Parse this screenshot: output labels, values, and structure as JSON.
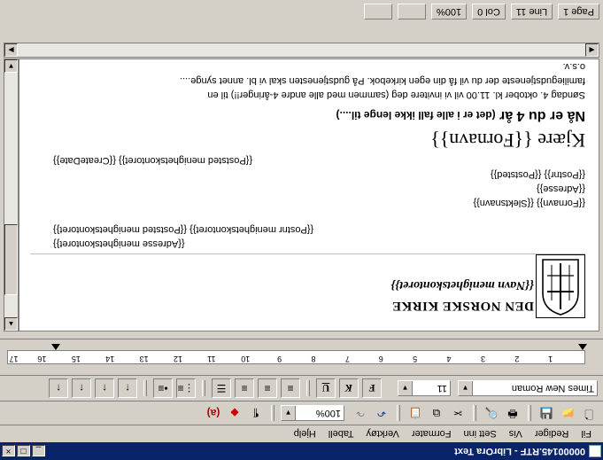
{
  "window": {
    "title": "00000145.RTF - LibrOra Text"
  },
  "menu": [
    "Fil",
    "Rediger",
    "Vis",
    "Sett inn",
    "Formater",
    "Verktøy",
    "Tabell",
    "Hjelp"
  ],
  "toolbar": {
    "zoom": "100%"
  },
  "format": {
    "font": "Times New Roman",
    "size": "11"
  },
  "ruler": {
    "numbers": [
      "1",
      "2",
      "3",
      "4",
      "5",
      "6",
      "7",
      "8",
      "9",
      "10",
      "11",
      "12",
      "13",
      "14",
      "15",
      "16",
      "17"
    ]
  },
  "document": {
    "church_name": "DEN NORSKE KIRKE",
    "office_name": "{{Navn menighetskontoret}}",
    "office_address": "{{Adresse menighetskontoret}}",
    "office_postal": "{{Postnr menighetskontoret}} {{Poststed menighetskontoret}}",
    "recipient_name": "{{Fornavn}} {{Slektsnavn}}",
    "recipient_address": "{{Adresse}}",
    "recipient_postal": "{{Postnr}} {{Poststed}}",
    "date_line": "{{Poststed menighetskontoret}} {{CreateDate}}",
    "greeting": "Kjære {{Fornavn}}",
    "headline": "Nå er du 4 år",
    "headline_sub": "(det er i alle fall ikke lenge til....)",
    "body_line1": "Søndag 4. oktober kl. 11.00 vil vi invitere deg (sammen med alle andre 4-åringer!!) til en",
    "body_line2": "familiegudstjeneste der du vil få din egen kirkebok. På gudstjenesten skal vi bl. annet synge....",
    "body_line3": "o.s.v."
  },
  "status": {
    "page": "Page 1",
    "line": "Line 11",
    "col": "Col 0",
    "zoom": "100%"
  }
}
